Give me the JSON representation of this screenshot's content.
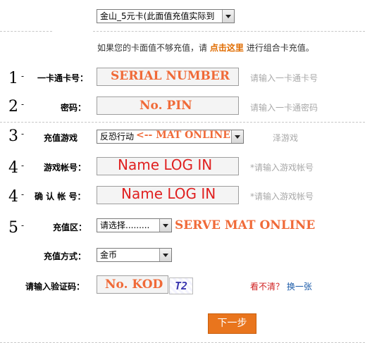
{
  "top_select": {
    "value": "金山_5元卡(此面值充值实际到"
  },
  "hint": {
    "prefix": "如果您的卡面值不够充值，请",
    "link": "点击这里",
    "suffix": "进行组合卡充值。"
  },
  "steps": {
    "s1": "1",
    "s2": "2",
    "s3": "3",
    "s4a": "4",
    "s4b": "4",
    "s5": "5",
    "dash": "-"
  },
  "rows": {
    "card_no": {
      "label": "一卡通卡号：",
      "overlay": "SERIAL NUMBER",
      "hint": "请输入一卡通卡号"
    },
    "password": {
      "label": "密码：",
      "overlay": "No. PIN",
      "hint": "请输入一卡通密码"
    },
    "game": {
      "label": "充值游戏",
      "value": "反恐行动",
      "overlay": "<-- MAT ONLINE",
      "hint": "泽游戏"
    },
    "account": {
      "label": "游戏帐号：",
      "overlay": "Name LOG IN",
      "hint": "*请输入游戏帐号"
    },
    "confirm": {
      "label": "确 认 帐 号：",
      "overlay": "Name LOG IN",
      "hint": "*请输入游戏帐号"
    },
    "server": {
      "label": "充值区：",
      "value": "请选择.........",
      "overlay": "SERVE MAT ONLINE"
    },
    "method": {
      "label": "充值方式：",
      "value": "金币"
    },
    "captcha": {
      "label": "请输入验证码：",
      "overlay": "No. KOD",
      "image_text": "T2",
      "unclear": "看不清？",
      "refresh": "换一张"
    }
  },
  "next_button": "下一步",
  "colors": {
    "accent": "#e9751d",
    "annotation_orange": "#f06a38",
    "annotation_red": "#e02020",
    "link_orange": "#e06c00",
    "hint_gray": "#a8a8a8",
    "field_bg": "#f4f4f4"
  }
}
